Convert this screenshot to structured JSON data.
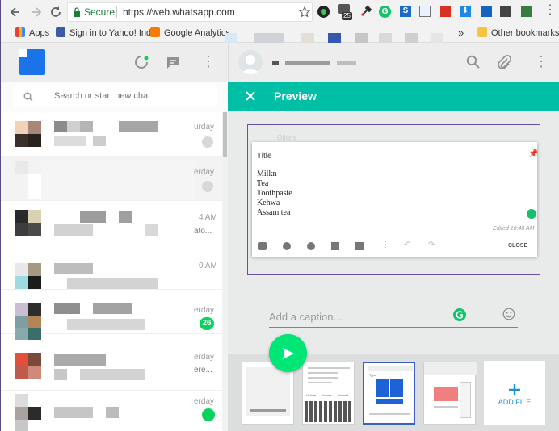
{
  "browser": {
    "secure_label": "Secure",
    "url": "https://web.whatsapp.com",
    "extension_badge_count": "25",
    "bookmarks": [
      {
        "label": "Apps"
      },
      {
        "label": "Sign in to Yahoo! Ind"
      },
      {
        "label": "Google Analytics"
      }
    ],
    "overflow_label": "»",
    "other_bookmarks_label": "Other bookmarks"
  },
  "left_pane": {
    "search_placeholder": "Search or start new chat",
    "chats": [
      {
        "time": "urday"
      },
      {
        "time": "erday"
      },
      {
        "time": "4 AM",
        "preview": "ato..."
      },
      {
        "time": "0 AM"
      },
      {
        "time": "erday",
        "unread": "26"
      },
      {
        "time": "erday",
        "preview": "ere..."
      },
      {
        "time": "erday"
      }
    ]
  },
  "preview": {
    "title": "Preview",
    "note": {
      "header_text": "Others",
      "title": "Title",
      "lines": [
        "Milkn",
        "Tea",
        "Toothpaste",
        "Kehwa",
        "Assam tea"
      ],
      "edited": "Edited 10:48 AM",
      "close_label": "CLOSE"
    },
    "caption_placeholder": "Add a caption..."
  },
  "attachments": {
    "add_file_label": "ADD FILE",
    "thumb1": {
      "labels": [
        "Kehwa",
        "Kehwa",
        "Unread"
      ]
    },
    "thumb2": {
      "labels": [
        "Type"
      ]
    }
  },
  "colors": {
    "accent": "#00bfa5",
    "send": "#00e676",
    "add_file": "#1d92d8"
  }
}
